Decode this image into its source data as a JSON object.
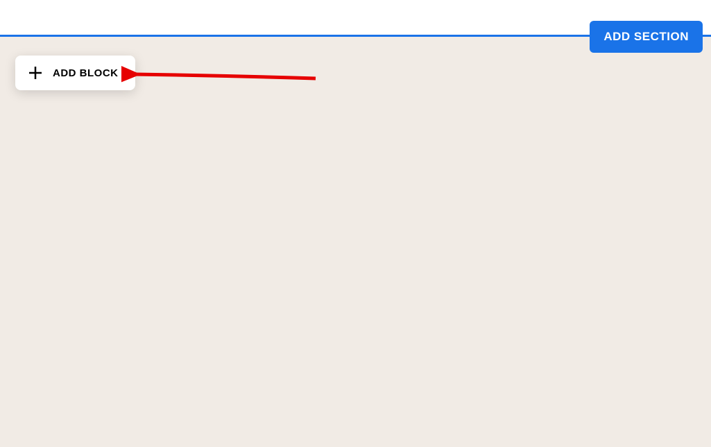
{
  "header": {
    "add_section_label": "ADD SECTION"
  },
  "canvas": {
    "add_block_label": "ADD BLOCK"
  }
}
